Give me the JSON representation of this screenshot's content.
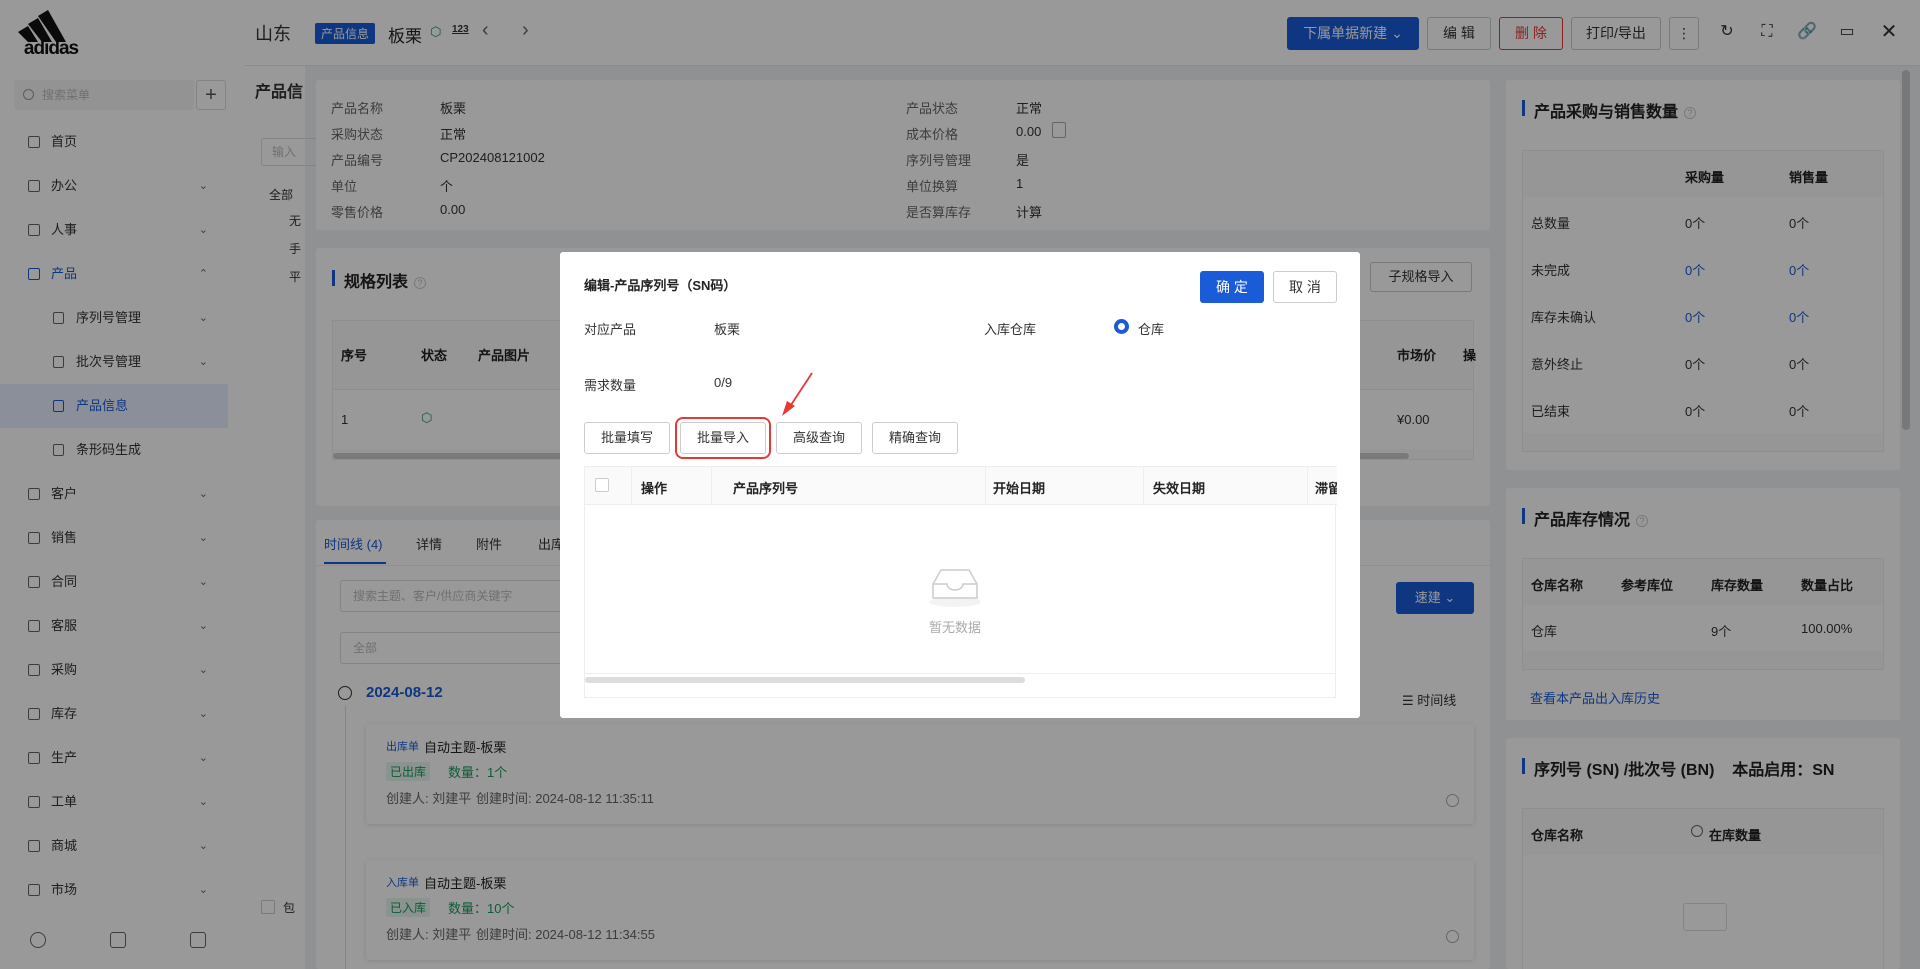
{
  "brand": {
    "logo_text": "adidas"
  },
  "sidebar": {
    "search_placeholder": "搜索菜单",
    "add_label": "+",
    "items": [
      {
        "label": "首页",
        "has_chevron": false
      },
      {
        "label": "办公",
        "has_chevron": true
      },
      {
        "label": "人事",
        "has_chevron": true
      },
      {
        "label": "产品",
        "has_chevron": true,
        "active": true
      },
      {
        "label": "客户",
        "has_chevron": true
      },
      {
        "label": "销售",
        "has_chevron": true
      },
      {
        "label": "合同",
        "has_chevron": true
      },
      {
        "label": "客服",
        "has_chevron": true
      },
      {
        "label": "采购",
        "has_chevron": true
      },
      {
        "label": "库存",
        "has_chevron": true
      },
      {
        "label": "生产",
        "has_chevron": true
      },
      {
        "label": "工单",
        "has_chevron": true
      },
      {
        "label": "商城",
        "has_chevron": true
      },
      {
        "label": "市场",
        "has_chevron": true
      }
    ],
    "sub_items": [
      {
        "label": "序列号管理"
      },
      {
        "label": "批次号管理"
      },
      {
        "label": "产品信息",
        "selected": true
      },
      {
        "label": "条形码生成"
      }
    ],
    "chevron_down": "⌄",
    "chevron_up": "⌃"
  },
  "header": {
    "company": "山东",
    "tag": "产品信息",
    "product_name": "板栗",
    "code_icon": "123",
    "prev": "‹",
    "next": "›",
    "buttons": {
      "new_sub": "下属单据新建",
      "edit": "编 辑",
      "delete": "删 除",
      "print": "打印/导出"
    }
  },
  "left_panel": {
    "title": "产品信",
    "input_ph": "输入",
    "tree": [
      "全部",
      "无",
      "手",
      "平"
    ],
    "checkbox_label": "包"
  },
  "product_info": {
    "fields_left": [
      {
        "label": "产品名称",
        "value": "板栗"
      },
      {
        "label": "采购状态",
        "value": "正常"
      },
      {
        "label": "产品编号",
        "value": "CP202408121002"
      },
      {
        "label": "单位",
        "value": "个"
      },
      {
        "label": "零售价格",
        "value": "0.00"
      }
    ],
    "fields_right": [
      {
        "label": "产品状态",
        "value": "正常"
      },
      {
        "label": "成本价格",
        "value": "0.00"
      },
      {
        "label": "序列号管理",
        "value": "是"
      },
      {
        "label": "单位换算",
        "value": "1"
      },
      {
        "label": "是否算库存",
        "value": "计算"
      }
    ]
  },
  "spec_list": {
    "title": "规格列表",
    "import_btn": "子规格导入",
    "headers": [
      "序号",
      "状态",
      "产品图片",
      "市场价",
      "操"
    ],
    "row": {
      "index": "1",
      "price": "¥0.00"
    }
  },
  "timeline": {
    "tabs": [
      "时间线 (4)",
      "详情",
      "附件",
      "出库"
    ],
    "search_ph": "搜索主题、客户/供应商关键字",
    "filter_ph": "全部",
    "quick_btn": "速建",
    "date": "2024-08-12",
    "timeline_label": "时间线",
    "items": [
      {
        "type": "出库单",
        "subject": "自动主题-板栗",
        "status": "已出库",
        "qty": "数量：1个",
        "creator": "创建人: 刘建平",
        "created": "创建时间: 2024-08-12 11:35:11"
      },
      {
        "type": "入库单",
        "subject": "自动主题-板栗",
        "status": "已入库",
        "qty": "数量：10个",
        "creator": "创建人: 刘建平",
        "created": "创建时间: 2024-08-12 11:34:55"
      }
    ]
  },
  "right_panel": {
    "purchase_title": "产品采购与销售数量",
    "purchase_headers": [
      "采购量",
      "销售量"
    ],
    "purchase_rows": [
      {
        "label": "总数量",
        "buy": "0个",
        "sell": "0个"
      },
      {
        "label": "未完成",
        "buy": "0个",
        "sell": "0个"
      },
      {
        "label": "库存未确认",
        "buy": "0个",
        "sell": "0个"
      },
      {
        "label": "意外终止",
        "buy": "0个",
        "sell": "0个"
      },
      {
        "label": "已结束",
        "buy": "0个",
        "sell": "0个"
      }
    ],
    "stock_title": "产品库存情况",
    "stock_headers": [
      "仓库名称",
      "参考库位",
      "库存数量",
      "数量占比"
    ],
    "stock_row": {
      "warehouse": "仓库",
      "location": "",
      "qty": "9个",
      "ratio": "100.00%"
    },
    "stock_link": "查看本产品出入库历史",
    "sn_title": "序列号 (SN) /批次号 (BN)    本品启用：SN",
    "sn_headers": [
      "仓库名称",
      "在库数量"
    ]
  },
  "modal": {
    "title": "编辑-产品序列号（SN码）",
    "ok": "确 定",
    "cancel": "取 消",
    "product_label": "对应产品",
    "product_value": "板栗",
    "warehouse_label": "入库仓库",
    "warehouse_value": "仓库",
    "qty_label": "需求数量",
    "qty_value": "0/9",
    "tools": [
      "批量填写",
      "批量导入",
      "高级查询",
      "精确查询"
    ],
    "headers": [
      "操作",
      "产品序列号",
      "开始日期",
      "失效日期",
      "滞留"
    ],
    "empty_text": "暂无数据"
  },
  "colors": {
    "accent": "#1a5bd8",
    "danger": "#e53935",
    "success": "#1a9a5a"
  }
}
